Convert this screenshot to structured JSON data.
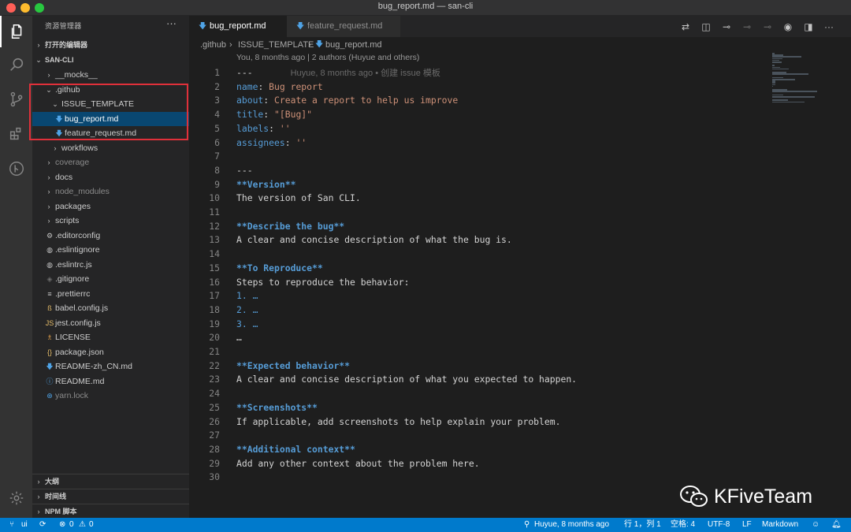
{
  "window": {
    "title": "bug_report.md — san-cli",
    "traffic_lights": [
      "#fe5f57",
      "#febc2e",
      "#28c840"
    ]
  },
  "activity_bar": {
    "items": [
      {
        "name": "explorer-icon"
      },
      {
        "name": "search-icon"
      },
      {
        "name": "source-control-icon"
      },
      {
        "name": "extensions-icon"
      },
      {
        "name": "git-history-icon"
      }
    ],
    "bottom": {
      "name": "settings-gear-icon"
    }
  },
  "sidebar": {
    "title": "资源管理器",
    "more": "···",
    "open_editors": "打开的编辑器",
    "project": "SAN-CLI",
    "tree": [
      {
        "label": "__mocks__",
        "type": "folder",
        "open": false,
        "depth": 1
      },
      {
        "label": ".github",
        "type": "folder",
        "open": true,
        "depth": 1
      },
      {
        "label": "ISSUE_TEMPLATE",
        "type": "folder",
        "open": true,
        "depth": 2
      },
      {
        "label": "bug_report.md",
        "type": "md",
        "depth": 3,
        "selected": true
      },
      {
        "label": "feature_request.md",
        "type": "md",
        "depth": 3
      },
      {
        "label": "workflows",
        "type": "folder",
        "open": false,
        "depth": 2
      },
      {
        "label": "coverage",
        "type": "folder",
        "open": false,
        "depth": 1,
        "dim": true
      },
      {
        "label": "docs",
        "type": "folder",
        "open": false,
        "depth": 1
      },
      {
        "label": "node_modules",
        "type": "folder",
        "open": false,
        "depth": 1,
        "dim": true
      },
      {
        "label": "packages",
        "type": "folder",
        "open": false,
        "depth": 1
      },
      {
        "label": "scripts",
        "type": "folder",
        "open": false,
        "depth": 1
      },
      {
        "label": ".editorconfig",
        "type": "gear",
        "depth": 1
      },
      {
        "label": ".eslintignore",
        "type": "circle",
        "depth": 1
      },
      {
        "label": ".eslintrc.js",
        "type": "circle",
        "depth": 1
      },
      {
        "label": ".gitignore",
        "type": "git",
        "depth": 1
      },
      {
        "label": ".prettierrc",
        "type": "lines",
        "depth": 1
      },
      {
        "label": "babel.config.js",
        "type": "babel",
        "depth": 1
      },
      {
        "label": "jest.config.js",
        "type": "js",
        "depth": 1
      },
      {
        "label": "LICENSE",
        "type": "license",
        "depth": 1
      },
      {
        "label": "package.json",
        "type": "json",
        "depth": 1
      },
      {
        "label": "README-zh_CN.md",
        "type": "md",
        "depth": 1
      },
      {
        "label": "README.md",
        "type": "info",
        "depth": 1
      },
      {
        "label": "yarn.lock",
        "type": "yarn",
        "depth": 1,
        "dim": true
      }
    ],
    "bottom_sections": [
      "大纲",
      "时间线",
      "NPM 脚本"
    ]
  },
  "tabs": [
    {
      "label": "bug_report.md",
      "active": true
    },
    {
      "label": "feature_request.md",
      "active": false
    }
  ],
  "breadcrumb": [
    ".github",
    "ISSUE_TEMPLATE",
    "bug_report.md"
  ],
  "editor": {
    "blame_header": "You, 8 months ago | 2 authors (Huyue and others)",
    "inline_blame": "Huyue, 8 months ago • 创建 issue 模板",
    "lines": [
      "---",
      "name: Bug report",
      "about: Create a report to help us improve",
      "title: \"[Bug]\"",
      "labels: ''",
      "assignees: ''",
      "",
      "---",
      "**Version**",
      "The version of San CLI.",
      "",
      "**Describe the bug**",
      "A clear and concise description of what the bug is.",
      "",
      "**To Reproduce**",
      "Steps to reproduce the behavior:",
      "1. …",
      "2. …",
      "3. …",
      "…",
      "",
      "**Expected behavior**",
      "A clear and concise description of what you expected to happen.",
      "",
      "**Screenshots**",
      "If applicable, add screenshots to help explain your problem.",
      "",
      "**Additional context**",
      "Add any other context about the problem here.",
      ""
    ]
  },
  "status_bar": {
    "branch": "ui",
    "problems": "0",
    "warnings": "0",
    "blame": "Huyue, 8 months ago",
    "position": "行 1，列 1",
    "indent": "空格: 4",
    "encoding": "UTF-8",
    "eol": "LF",
    "language": "Markdown"
  },
  "watermark": {
    "text": "KFiveTeam"
  }
}
